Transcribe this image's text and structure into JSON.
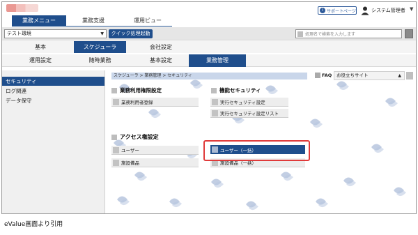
{
  "header": {
    "nav_tabs": [
      "業務メニュー",
      "業務支援",
      "運用ビュー"
    ],
    "support_label": "サポートページ",
    "support_icon": "info-circle-icon",
    "user_name": "システム管理者",
    "user_caret": "▼"
  },
  "toolbar": {
    "environment_value": "テスト環境",
    "quick_launch_label": "クイック処理起動",
    "search_placeholder": "処理名で検索を入力します"
  },
  "tabs_row1": [
    "基本",
    "スケジューラ",
    "会社設定"
  ],
  "tabs_row2": [
    "運用設定",
    "随時業務",
    "基本設定",
    "業務管理"
  ],
  "sidebar": {
    "items": [
      {
        "label": "セキュリティ",
        "active": true
      },
      {
        "label": "ログ関連",
        "active": false
      },
      {
        "label": "データ保守",
        "active": false
      }
    ]
  },
  "main": {
    "breadcrumb": "スケジューラ > 業務管理 > セキュリティ",
    "faq_label": "FAQ",
    "useful_sites_label": "お役立ちサイト",
    "useful_sites_toggle": "▲",
    "sections": {
      "usage_rights": {
        "title": "業務利用権限設定",
        "items": [
          "業務利用者登録"
        ]
      },
      "function_security": {
        "title": "機能セキュリティ",
        "items": [
          "実行セキュリティ設定",
          "実行セキュリティ設定リスト"
        ]
      },
      "access_rights": {
        "title": "アクセス権設定",
        "items": [
          "ユーザー",
          "施設備品",
          "ユーザー（一括）",
          "施設備品（一括）"
        ]
      }
    }
  },
  "caption": "eValue画面より引用",
  "colors": {
    "accent": "#1f4e8c",
    "highlight": "#e03a3a"
  }
}
